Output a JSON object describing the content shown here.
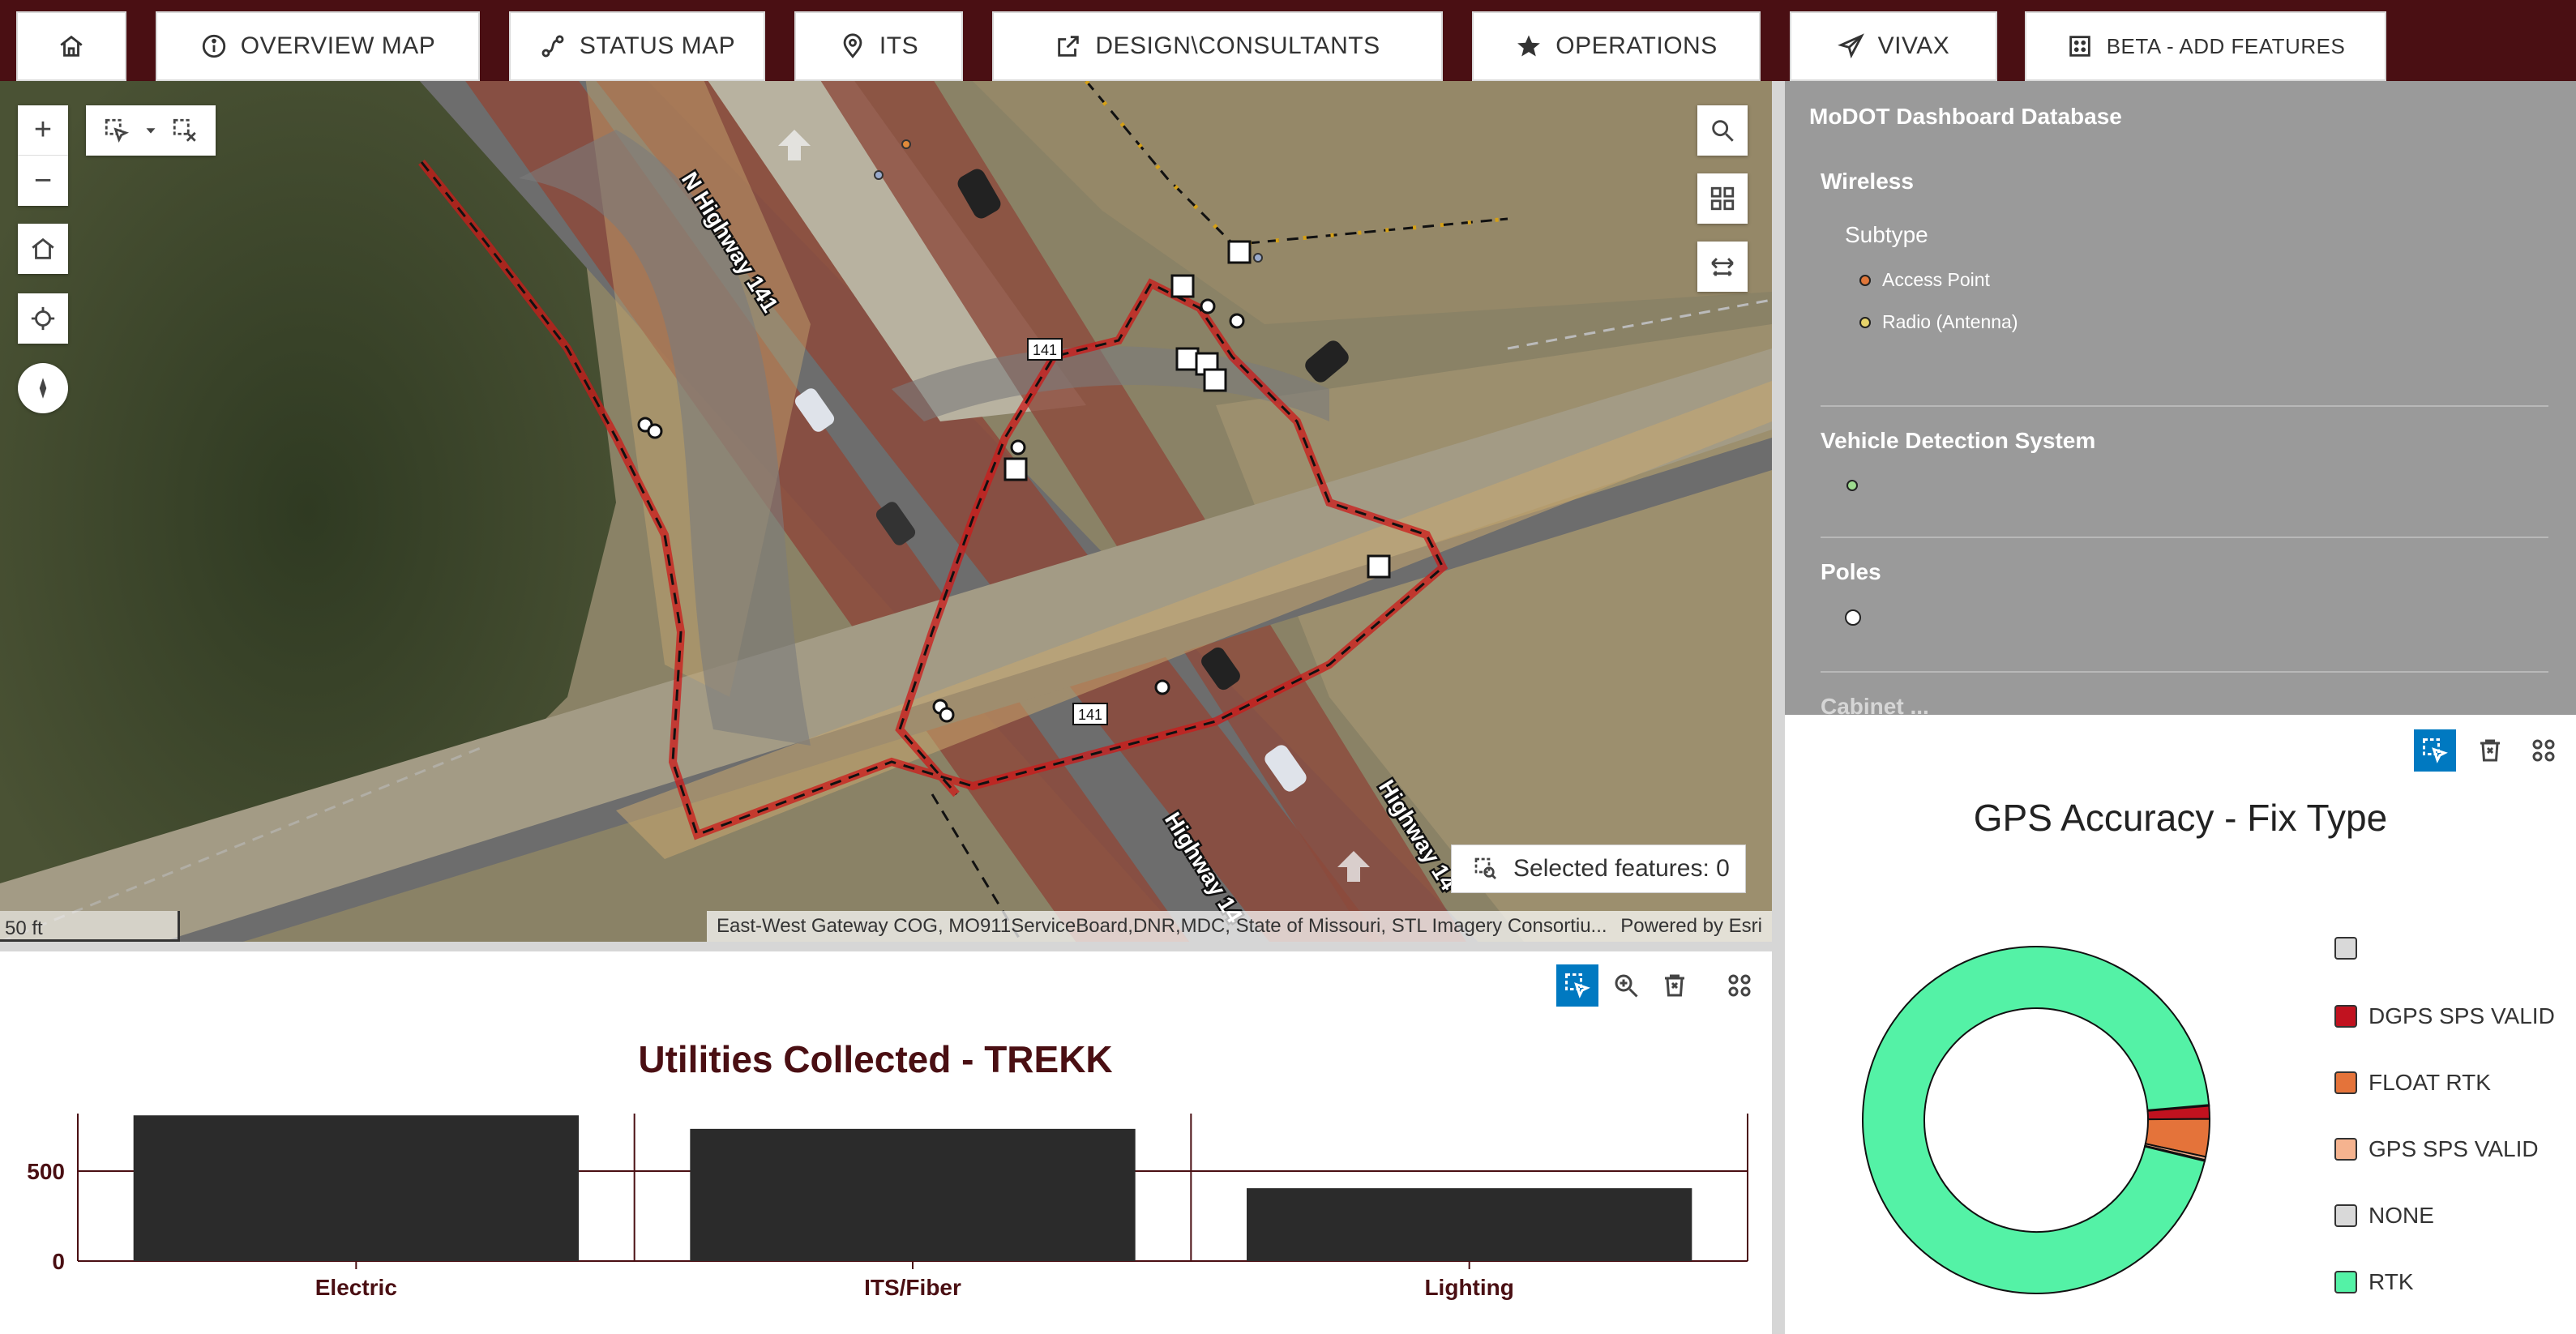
{
  "nav": {
    "home_label": "",
    "items": [
      {
        "label": "OVERVIEW MAP",
        "icon": "info-icon"
      },
      {
        "label": "STATUS MAP",
        "icon": "route-icon"
      },
      {
        "label": "ITS",
        "icon": "pin-icon"
      },
      {
        "label": "DESIGN\\CONSULTANTS",
        "icon": "launch-icon"
      },
      {
        "label": "OPERATIONS",
        "icon": "star-icon"
      },
      {
        "label": "VIVAX",
        "icon": "send-icon"
      },
      {
        "label": "BETA - ADD FEATURES",
        "icon": "grid-dots-icon"
      }
    ]
  },
  "map": {
    "labels": {
      "road1": "N Highway 141",
      "road2": "Highway 14",
      "road3": "Highway 14",
      "shield1": "141",
      "shield2": "141"
    },
    "selected_features": "Selected features: 0",
    "scale": "50 ft",
    "attribution": "East-West Gateway COG, MO911ServiceBoard,DNR,MDC, State of Missouri, STL Imagery Consortiu...",
    "powered_by": "Powered by Esri"
  },
  "legend": {
    "title": "MoDOT Dashboard Database",
    "wireless": "Wireless",
    "subtype": "Subtype",
    "access_point": "Access Point",
    "radio": "Radio (Antenna)",
    "vds": "Vehicle Detection System",
    "poles": "Poles",
    "cut_off": "Cabinet  ..."
  },
  "colors": {
    "nav_bg": "#4a0f13",
    "accent": "#0079c1",
    "bar_color": "#2b2b2b",
    "bar_title": "#4a0f13"
  },
  "chart_data": [
    {
      "type": "pie",
      "title": "GPS Accuracy - Fix Type",
      "donut": true,
      "legend_position": "right",
      "categories": [
        "",
        "DGPS SPS VALID",
        "FLOAT RTK",
        "GPS SPS VALID",
        "NONE",
        "RTK"
      ],
      "values": [
        0.1,
        1.2,
        3.5,
        0.3,
        0.1,
        94.8
      ],
      "colors": [
        "#d9d9d9",
        "#c1121f",
        "#e4733a",
        "#f5b38f",
        "#d9d9d9",
        "#54f2a6"
      ]
    },
    {
      "type": "bar",
      "title": "Utilities Collected - TREKK",
      "categories": [
        "Electric",
        "ITS/Fiber",
        "Lighting"
      ],
      "values": [
        810,
        735,
        405
      ],
      "ylim": [
        0,
        820
      ],
      "yticks": [
        0,
        500
      ],
      "grid": true
    }
  ]
}
